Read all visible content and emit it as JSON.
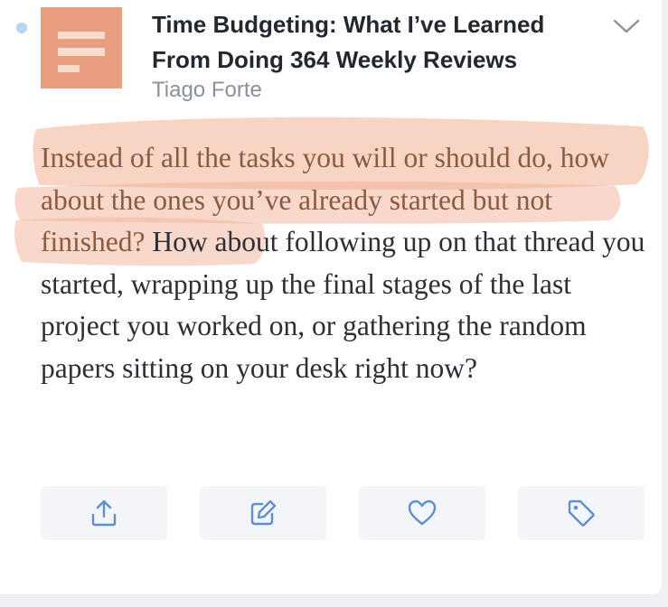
{
  "highlight": {
    "book_title": "Time Budgeting: What I’ve Learned From Doing 364 Weekly Reviews",
    "author": "Tiago Forte",
    "quote_highlighted_part": "Instead of all the tasks you will or should do, how about the ones you’ve already started but not finished?",
    "quote_rest": " How about following up on that thread you started, wrapping up the final stages of the last project you worked on, or gathering the random papers sitting on your desk right now?"
  },
  "colors": {
    "thumbnail": "#e99f7f",
    "highlight_stroke": "#f2b196",
    "icon_blue": "#5b8fd6",
    "unread_dot": "#b9d4f2"
  },
  "icons": {
    "expand": "chevron-down-icon",
    "actions": [
      "share-icon",
      "edit-icon",
      "heart-icon",
      "tag-icon"
    ]
  }
}
